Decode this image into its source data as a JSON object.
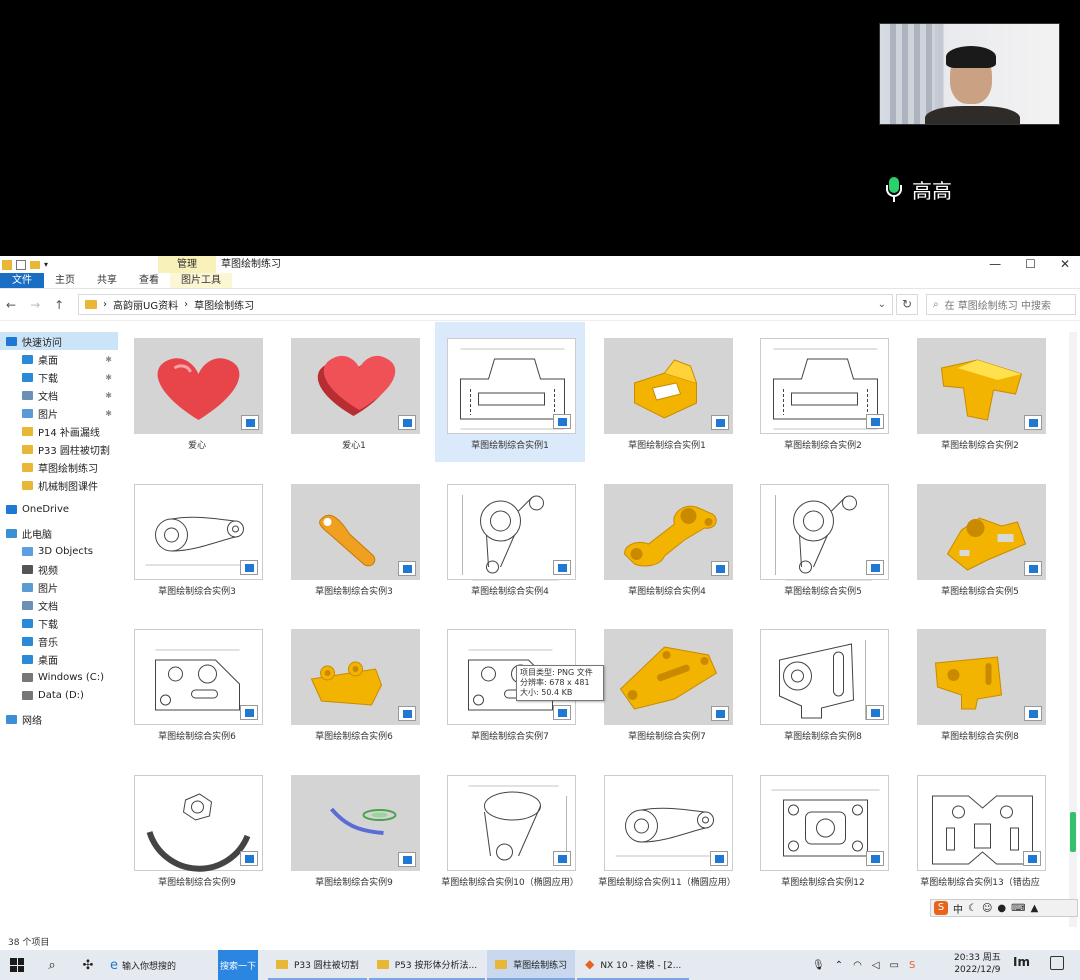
{
  "meeting": {
    "speaker_name": "高高"
  },
  "window": {
    "manage_tab": "管理",
    "title": "草图绘制练习",
    "controls": [
      "—",
      "☐",
      "✕"
    ]
  },
  "ribbon": {
    "tabs": [
      "文件",
      "主页",
      "共享",
      "查看",
      "图片工具"
    ]
  },
  "address": {
    "crumbs": [
      "高韵丽UG资料",
      "草图绘制练习"
    ],
    "separator": "›",
    "search_placeholder": "在 草图绘制练习 中搜索"
  },
  "sidebar": {
    "items": [
      {
        "label": "快速访问",
        "icon": "star-icon",
        "color": "#1f78d1",
        "top": true
      },
      {
        "label": "桌面",
        "icon": "desktop-icon",
        "color": "#2b8ad8",
        "pinned": true
      },
      {
        "label": "下载",
        "icon": "download-icon",
        "color": "#2b8ad8",
        "pinned": true
      },
      {
        "label": "文档",
        "icon": "document-icon",
        "color": "#6b8fb5",
        "pinned": true
      },
      {
        "label": "图片",
        "icon": "pictures-icon",
        "color": "#5b9bd5",
        "pinned": true
      },
      {
        "label": "P14 补画漏线",
        "icon": "folder-icon",
        "color": "#e8b735"
      },
      {
        "label": "P33 圆柱被切割",
        "icon": "folder-icon",
        "color": "#e8b735"
      },
      {
        "label": "草图绘制练习",
        "icon": "folder-icon",
        "color": "#e8b735"
      },
      {
        "label": "机械制图课件",
        "icon": "folder-icon",
        "color": "#e8b735"
      },
      {
        "label": "OneDrive",
        "icon": "cloud-icon",
        "color": "#1f78d1",
        "top": true,
        "gap": true
      },
      {
        "label": "此电脑",
        "icon": "computer-icon",
        "color": "#3c8fd5",
        "top": true,
        "gap": true
      },
      {
        "label": "3D Objects",
        "icon": "cube-icon",
        "color": "#5aa0e0"
      },
      {
        "label": "视频",
        "icon": "video-icon",
        "color": "#555"
      },
      {
        "label": "图片",
        "icon": "pictures-icon",
        "color": "#5b9bd5"
      },
      {
        "label": "文档",
        "icon": "document-icon",
        "color": "#6b8fb5"
      },
      {
        "label": "下载",
        "icon": "download-icon",
        "color": "#2b8ad8"
      },
      {
        "label": "音乐",
        "icon": "music-icon",
        "color": "#2b8ad8"
      },
      {
        "label": "桌面",
        "icon": "desktop-icon",
        "color": "#2b8ad8"
      },
      {
        "label": "Windows (C:)",
        "icon": "drive-icon",
        "color": "#777"
      },
      {
        "label": "Data (D:)",
        "icon": "drive-icon",
        "color": "#777"
      },
      {
        "label": "网络",
        "icon": "network-icon",
        "color": "#3c8fd5",
        "top": true,
        "gap": true
      }
    ]
  },
  "files": [
    {
      "name": "爱心",
      "kind": "heart",
      "bg": "grey"
    },
    {
      "name": "爱心1",
      "kind": "heart2",
      "bg": "grey"
    },
    {
      "name": "草图绘制综合实例1",
      "kind": "drawing",
      "bg": "white",
      "hover": true
    },
    {
      "name": "草图绘制综合实例1",
      "kind": "part1",
      "bg": "grey"
    },
    {
      "name": "草图绘制综合实例2",
      "kind": "drawing",
      "bg": "white"
    },
    {
      "name": "草图绘制综合实例2",
      "kind": "part2",
      "bg": "grey"
    },
    {
      "name": "草图绘制综合实例3",
      "kind": "drawing-lever",
      "bg": "white"
    },
    {
      "name": "草图绘制综合实例3",
      "kind": "lever",
      "bg": "grey"
    },
    {
      "name": "草图绘制综合实例4",
      "kind": "drawing-arm",
      "bg": "white"
    },
    {
      "name": "草图绘制综合实例4",
      "kind": "arm",
      "bg": "grey"
    },
    {
      "name": "草图绘制综合实例5",
      "kind": "drawing-arm",
      "bg": "white"
    },
    {
      "name": "草图绘制综合实例5",
      "kind": "arm2",
      "bg": "grey"
    },
    {
      "name": "草图绘制综合实例6",
      "kind": "drawing-plate",
      "bg": "white"
    },
    {
      "name": "草图绘制综合实例6",
      "kind": "plate",
      "bg": "grey"
    },
    {
      "name": "草图绘制综合实例7",
      "kind": "drawing-plate",
      "bg": "white"
    },
    {
      "name": "草图绘制综合实例7",
      "kind": "plate2",
      "bg": "grey"
    },
    {
      "name": "草图绘制综合实例8",
      "kind": "drawing-bracket",
      "bg": "white"
    },
    {
      "name": "草图绘制综合实例8",
      "kind": "bracket",
      "bg": "grey"
    },
    {
      "name": "草图绘制综合实例9",
      "kind": "drawing-arc",
      "bg": "white"
    },
    {
      "name": "草图绘制综合实例9",
      "kind": "curve",
      "bg": "grey"
    },
    {
      "name": "草图绘制综合实例10（椭圆应用）",
      "kind": "drawing-ellipse",
      "bg": "white"
    },
    {
      "name": "草图绘制综合实例11（椭圆应用）",
      "kind": "drawing-lever",
      "bg": "white"
    },
    {
      "name": "草图绘制综合实例12",
      "kind": "drawing-block",
      "bg": "white"
    },
    {
      "name": "草图绘制综合实例13（错齿应",
      "kind": "drawing-teeth",
      "bg": "white"
    }
  ],
  "tooltip": {
    "lines": [
      "项目类型: PNG 文件",
      "分辨率: 678 x 481",
      "大小: 50.4 KB"
    ]
  },
  "status": {
    "count": "38 个项目"
  },
  "ime": {
    "logo": "S",
    "lang": "中"
  },
  "taskbar": {
    "search_text": "输入你想搜的",
    "search_button": "搜索一下",
    "apps": [
      {
        "label": "P33 圆柱被切割",
        "icon": "folder-icon"
      },
      {
        "label": "P53 按形体分析法...",
        "icon": "folder-icon"
      },
      {
        "label": "草图绘制练习",
        "icon": "folder-icon",
        "active": true
      },
      {
        "label": "NX 10 - 建模 - [2...",
        "icon": "nx-icon"
      }
    ],
    "time": "20:33 周五",
    "date": "2022/12/9"
  },
  "colors": {
    "accent": "#1a6fc4",
    "manage_tab": "#f8f1b9",
    "part_yellow": "#f2b400",
    "heart_red": "#e8454a",
    "mic_green": "#29d06b"
  }
}
